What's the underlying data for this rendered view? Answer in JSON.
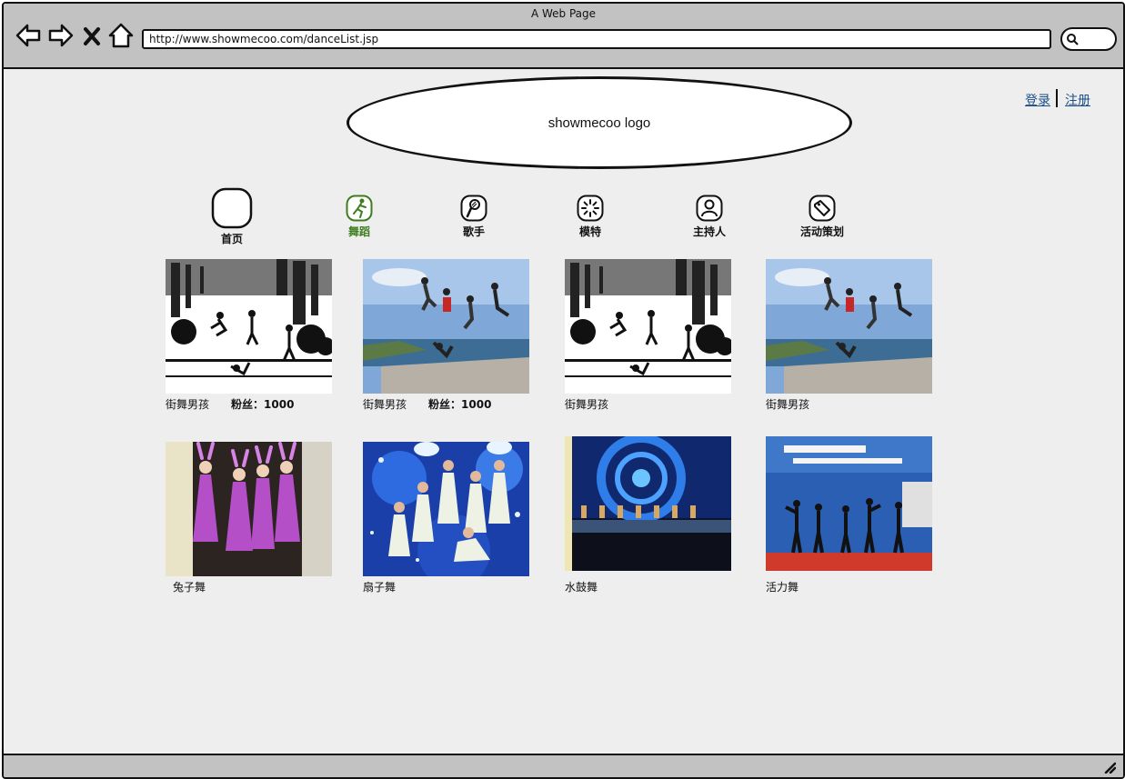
{
  "browser": {
    "title": "A Web Page",
    "url": "http://www.showmecoo.com/danceList.jsp",
    "icons": {
      "back": "back-arrow-icon",
      "forward": "forward-arrow-icon",
      "stop": "close-icon",
      "home": "home-icon",
      "search": "search-icon",
      "resize": "resize-grip-icon"
    }
  },
  "header": {
    "logo_text": "showmecoo logo",
    "login": "登录",
    "register": "注册"
  },
  "nav": [
    {
      "label": "首页",
      "icon": "blank-rounded-square-icon",
      "active": false
    },
    {
      "label": "舞蹈",
      "icon": "dancer-icon",
      "active": true
    },
    {
      "label": "歌手",
      "icon": "microphone-icon",
      "active": false
    },
    {
      "label": "模特",
      "icon": "camera-shutter-icon",
      "active": false
    },
    {
      "label": "主持人",
      "icon": "person-icon",
      "active": false
    },
    {
      "label": "活动策划",
      "icon": "tag-icon",
      "active": false
    }
  ],
  "gallery": [
    {
      "name": "街舞男孩",
      "fans": "粉丝：1000",
      "image": "street-dance-photo-bw"
    },
    {
      "name": "街舞男孩",
      "fans": "粉丝：1000",
      "image": "street-dance-photo-color"
    },
    {
      "name": "街舞男孩",
      "image": "street-dance-photo-bw"
    },
    {
      "name": "街舞男孩",
      "image": "street-dance-photo-color"
    },
    {
      "name": "兔子舞",
      "image": "bunny-dance-photo"
    },
    {
      "name": "扇子舞",
      "image": "fan-dance-photo"
    },
    {
      "name": "水鼓舞",
      "image": "water-drum-dance-photo"
    },
    {
      "name": "活力舞",
      "image": "vitality-dance-photo"
    }
  ],
  "colors": {
    "chrome": "#c2c2c2",
    "page_bg": "#eeeeee",
    "active_nav": "#3e7d1f",
    "link": "#1a4f8a"
  }
}
